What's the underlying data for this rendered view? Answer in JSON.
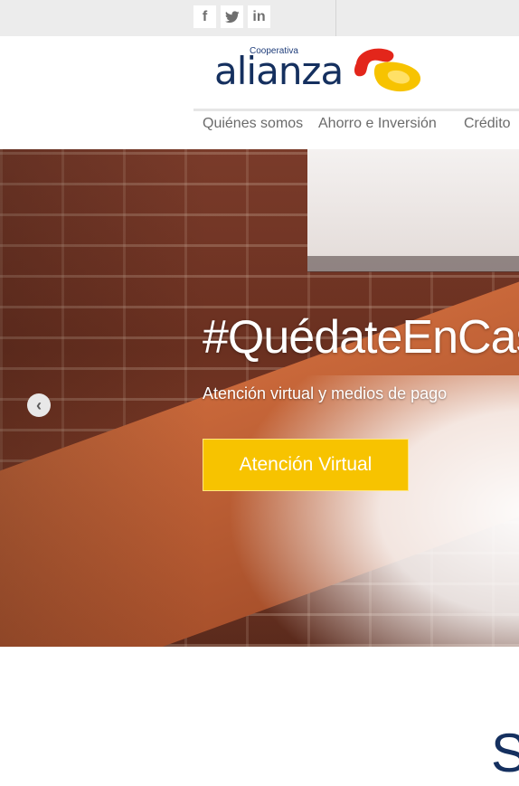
{
  "social": {
    "facebook_glyph": "f",
    "twitter_glyph": "🐦",
    "linkedin_glyph": "in"
  },
  "logo": {
    "tagline": "Cooperativa",
    "name": "alianza",
    "colors": {
      "text": "#15305f",
      "red": "#e3261b",
      "yellow": "#f7c300"
    }
  },
  "nav": {
    "items": [
      {
        "label": "Quiénes somos"
      },
      {
        "label": "Ahorro e Inversión"
      },
      {
        "label": "Crédito"
      }
    ]
  },
  "hero": {
    "title": "#QuédateEnCasa",
    "subtitle": "Atención virtual y medios de pago",
    "button_label": "Atención Virtual",
    "button_color": "#f7c300",
    "prev_icon": "chevron-left-icon"
  },
  "section": {
    "heading_partial": "S"
  }
}
